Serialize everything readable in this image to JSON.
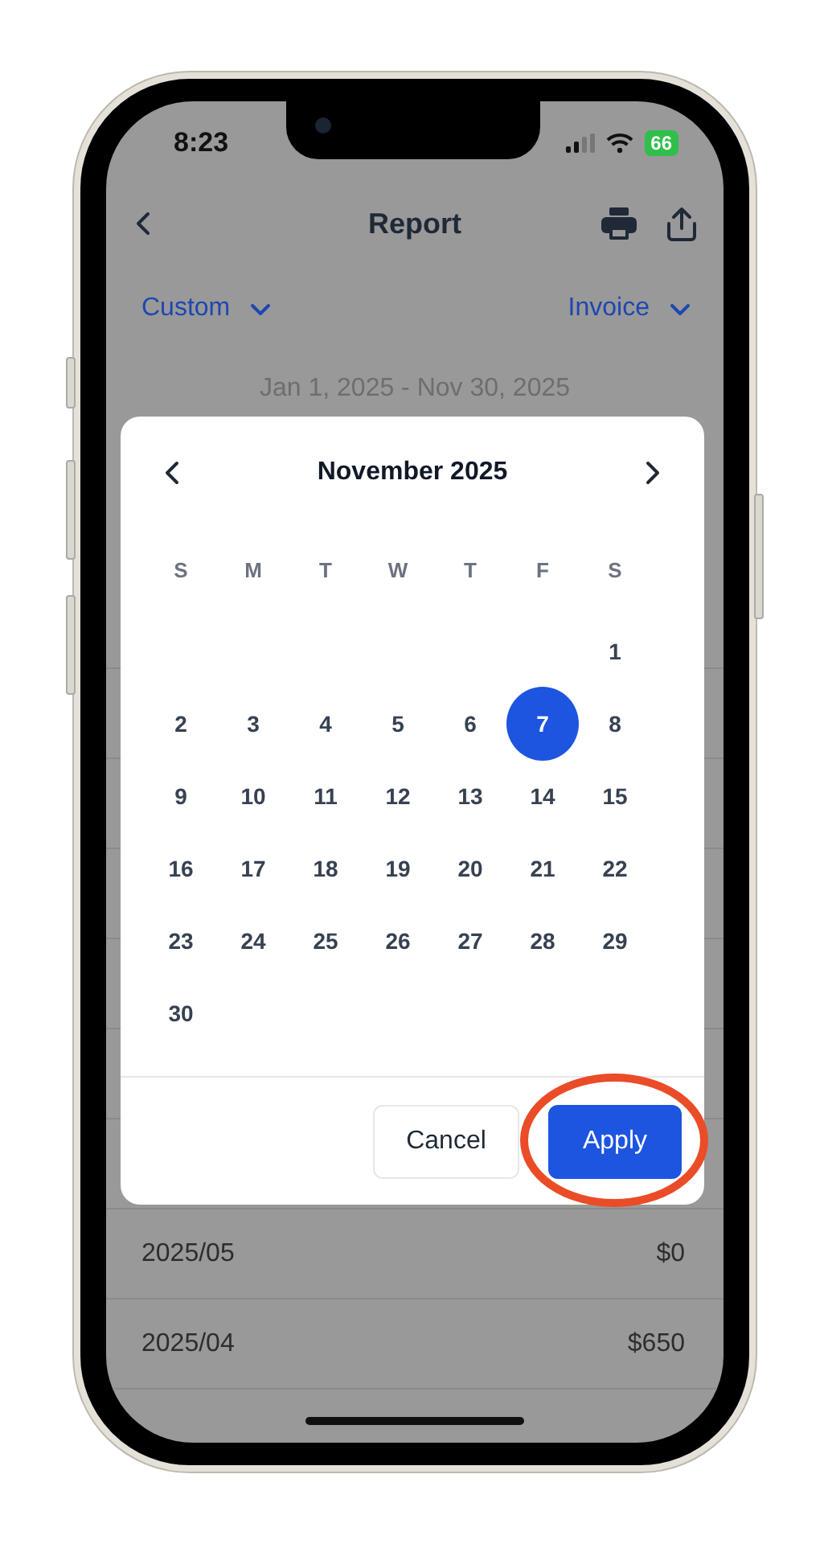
{
  "status_bar": {
    "time": "8:23",
    "battery": "66"
  },
  "nav": {
    "title": "Report"
  },
  "filters": [
    {
      "label": "Custom"
    },
    {
      "label": "Invoice"
    }
  ],
  "date_range": "Jan 1, 2025 - Nov 30, 2025",
  "rows": [
    {
      "period": "2025/05",
      "amount": "$0"
    },
    {
      "period": "2025/04",
      "amount": "$650"
    }
  ],
  "date_picker": {
    "month": "November 2025",
    "weekdays": [
      "S",
      "M",
      "T",
      "W",
      "T",
      "F",
      "S"
    ],
    "weeks": [
      {
        "kind": "first",
        "days": [
          {
            "day": "1",
            "selected": false
          }
        ]
      },
      {
        "kind": "full",
        "days": [
          {
            "day": "2",
            "selected": false
          },
          {
            "day": "3",
            "selected": false
          },
          {
            "day": "4",
            "selected": false
          },
          {
            "day": "5",
            "selected": false
          },
          {
            "day": "6",
            "selected": false
          },
          {
            "day": "7",
            "selected": true
          },
          {
            "day": "8",
            "selected": false
          }
        ]
      },
      {
        "kind": "full",
        "days": [
          {
            "day": "9",
            "selected": false
          },
          {
            "day": "10",
            "selected": false
          },
          {
            "day": "11",
            "selected": false
          },
          {
            "day": "12",
            "selected": false
          },
          {
            "day": "13",
            "selected": false
          },
          {
            "day": "14",
            "selected": false
          },
          {
            "day": "15",
            "selected": false
          }
        ]
      },
      {
        "kind": "full",
        "days": [
          {
            "day": "16",
            "selected": false
          },
          {
            "day": "17",
            "selected": false
          },
          {
            "day": "18",
            "selected": false
          },
          {
            "day": "19",
            "selected": false
          },
          {
            "day": "20",
            "selected": false
          },
          {
            "day": "21",
            "selected": false
          },
          {
            "day": "22",
            "selected": false
          }
        ]
      },
      {
        "kind": "full",
        "days": [
          {
            "day": "23",
            "selected": false
          },
          {
            "day": "24",
            "selected": false
          },
          {
            "day": "25",
            "selected": false
          },
          {
            "day": "26",
            "selected": false
          },
          {
            "day": "27",
            "selected": false
          },
          {
            "day": "28",
            "selected": false
          },
          {
            "day": "29",
            "selected": false
          }
        ]
      },
      {
        "kind": "last",
        "days": [
          {
            "day": "30",
            "selected": false
          }
        ]
      }
    ],
    "buttons": [
      {
        "label": "Cancel",
        "kind": "secondary"
      },
      {
        "label": "Apply",
        "kind": "primary"
      }
    ]
  }
}
